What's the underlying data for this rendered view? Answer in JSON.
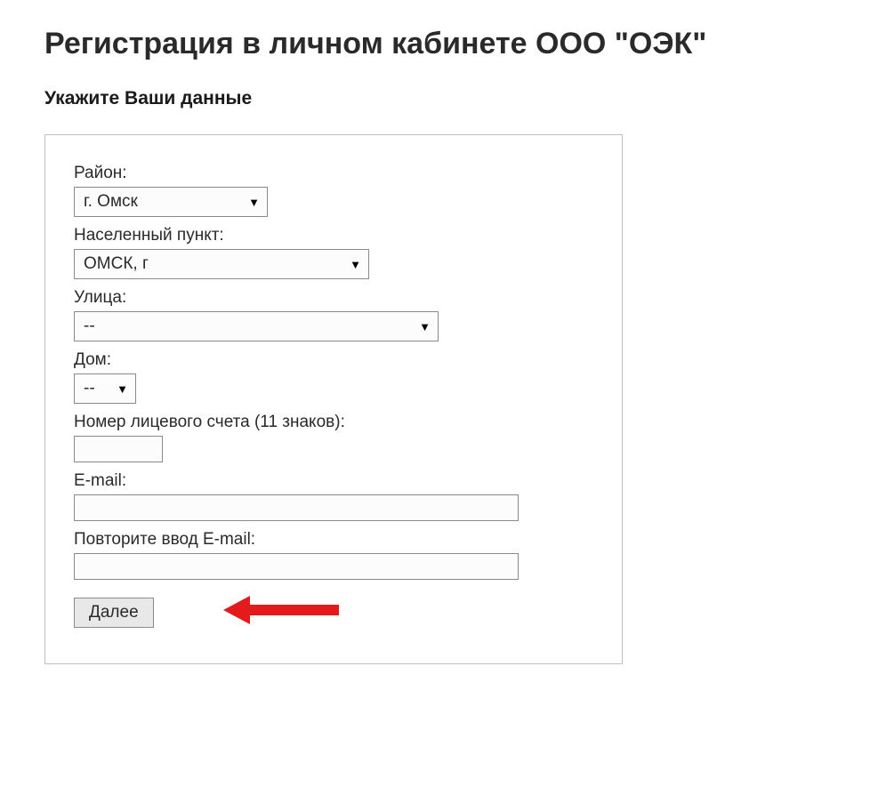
{
  "heading": "Регистрация в личном кабинете ООО \"ОЭК\"",
  "subheading": "Укажите Ваши данные",
  "form": {
    "district": {
      "label": "Район:",
      "value": "г. Омск"
    },
    "settlement": {
      "label": "Населенный пункт:",
      "value": "ОМСК, г"
    },
    "street": {
      "label": "Улица:",
      "value": "--"
    },
    "house": {
      "label": "Дом:",
      "value": "--"
    },
    "account": {
      "label": "Номер лицевого счета (11 знаков):",
      "value": ""
    },
    "email": {
      "label": "E-mail:",
      "value": ""
    },
    "email_confirm": {
      "label": "Повторите ввод E-mail:",
      "value": ""
    },
    "submit_label": "Далее"
  }
}
